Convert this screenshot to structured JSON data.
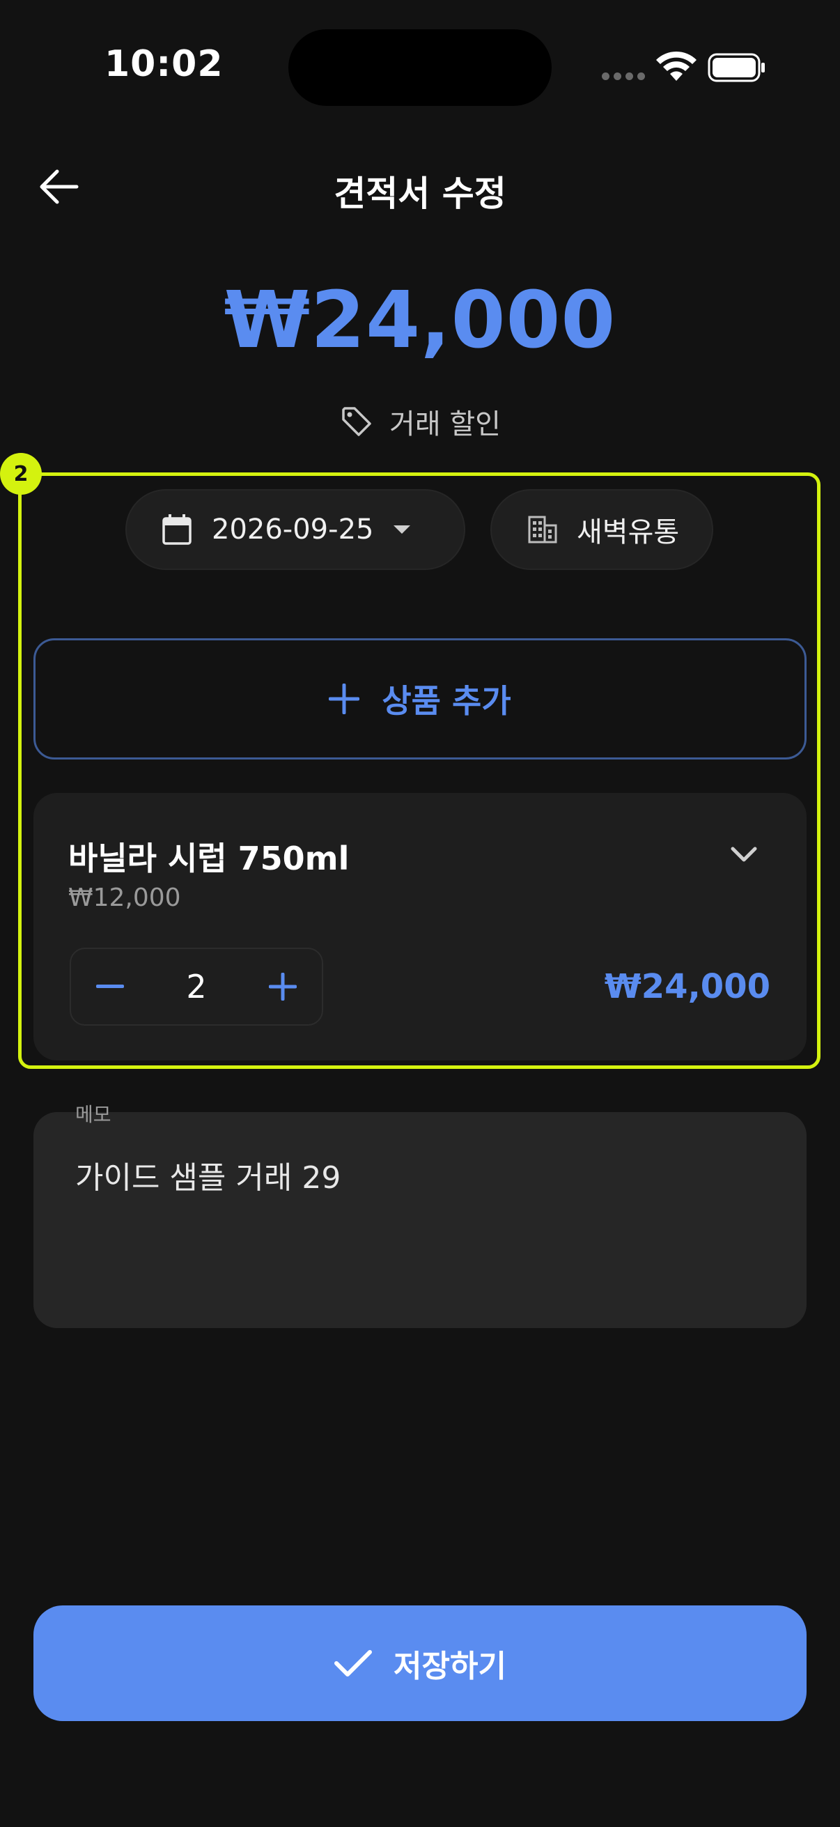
{
  "status_bar": {
    "time": "10:02"
  },
  "header": {
    "title": "견적서 수정"
  },
  "summary": {
    "total": "₩24,000",
    "discount_label": "거래 할인"
  },
  "annotation": {
    "badge": "2"
  },
  "filters": {
    "date": "2026-09-25",
    "vendor": "새벽유통"
  },
  "add_product": {
    "label": "상품 추가"
  },
  "item": {
    "name": "바닐라 시럽 750ml",
    "unit_price": "₩12,000",
    "quantity": "2",
    "line_total": "₩24,000"
  },
  "memo": {
    "label": "메모",
    "value": "가이드 샘플 거래 29"
  },
  "save": {
    "label": "저장하기"
  },
  "colors": {
    "accent": "#5a8cf0",
    "highlight": "#d4f20f",
    "background": "#121212"
  },
  "icons": [
    "back-arrow-icon",
    "tag-icon",
    "calendar-icon",
    "caret-down-icon",
    "building-icon",
    "plus-icon",
    "chevron-down-icon",
    "minus-icon",
    "check-icon",
    "wifi-icon",
    "battery-icon"
  ]
}
